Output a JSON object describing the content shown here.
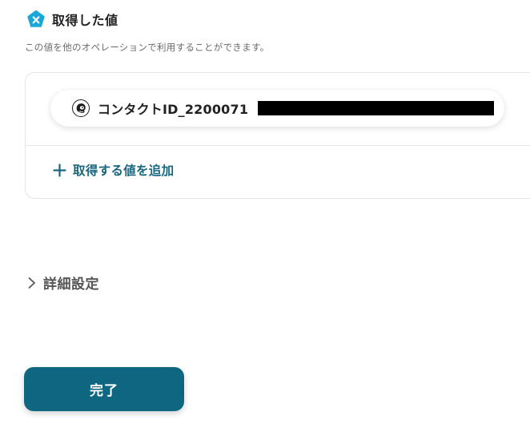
{
  "section": {
    "title": "取得した値",
    "description": "この値を他のオペレーションで利用することができます。"
  },
  "values": {
    "items": [
      {
        "label": "コンタクトID_2200071",
        "icon": "mailchimp-icon"
      }
    ],
    "add_label": "取得する値を追加"
  },
  "advanced": {
    "label": "詳細設定"
  },
  "footer": {
    "complete_label": "完了"
  },
  "colors": {
    "accent": "#0e6680",
    "link": "#17667d",
    "badge": "#1aa7d9"
  }
}
